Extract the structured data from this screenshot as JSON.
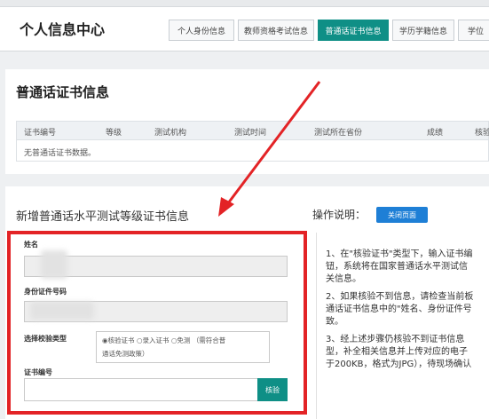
{
  "header": {
    "title": "个人信息中心",
    "tabs": [
      {
        "label": "个人身份信息",
        "active": false
      },
      {
        "label": "教师资格考试信息",
        "active": false
      },
      {
        "label": "普通话证书信息",
        "active": true
      },
      {
        "label": "学历学籍信息",
        "active": false
      },
      {
        "label": "学位",
        "active": false
      }
    ]
  },
  "certificate_panel": {
    "title": "普通话证书信息",
    "columns": [
      "证书编号",
      "等级",
      "测试机构",
      "测试时间",
      "测试所在省份",
      "成绩",
      "核验"
    ],
    "empty_text": "无普通话证书数据。"
  },
  "add_panel": {
    "title": "新增普通话水平测试等级证书信息",
    "instructions_label": "操作说明：",
    "close_button": "关闭页面",
    "form": {
      "name_label": "姓名",
      "id_label": "身份证件号码",
      "verify_type_label": "选择校验类型",
      "verify_options": [
        "核验证书",
        "录入证书",
        "免测"
      ],
      "verify_note_1": "（需符合普",
      "verify_note_2": "通话免测政策）",
      "cert_no_label": "证书编号",
      "verify_button": "核验"
    },
    "instructions": [
      "1、在\"核验证书\"类型下，输入证书编",
      "钮，系统将在国家普通话水平测试信",
      "关信息。",
      "2、如果核验不到信息，请检查当前板",
      "通话证书信息中的\"姓名、身份证件号",
      "致。",
      "3、经上述步骤仍核验不到证书信息",
      "型，补全相关信息并上传对应的电子",
      "于200KB，格式为JPG），待现场确认"
    ]
  },
  "colors": {
    "accent": "#0f8f86",
    "highlight": "#e32326",
    "button_blue": "#1e7fd6"
  }
}
